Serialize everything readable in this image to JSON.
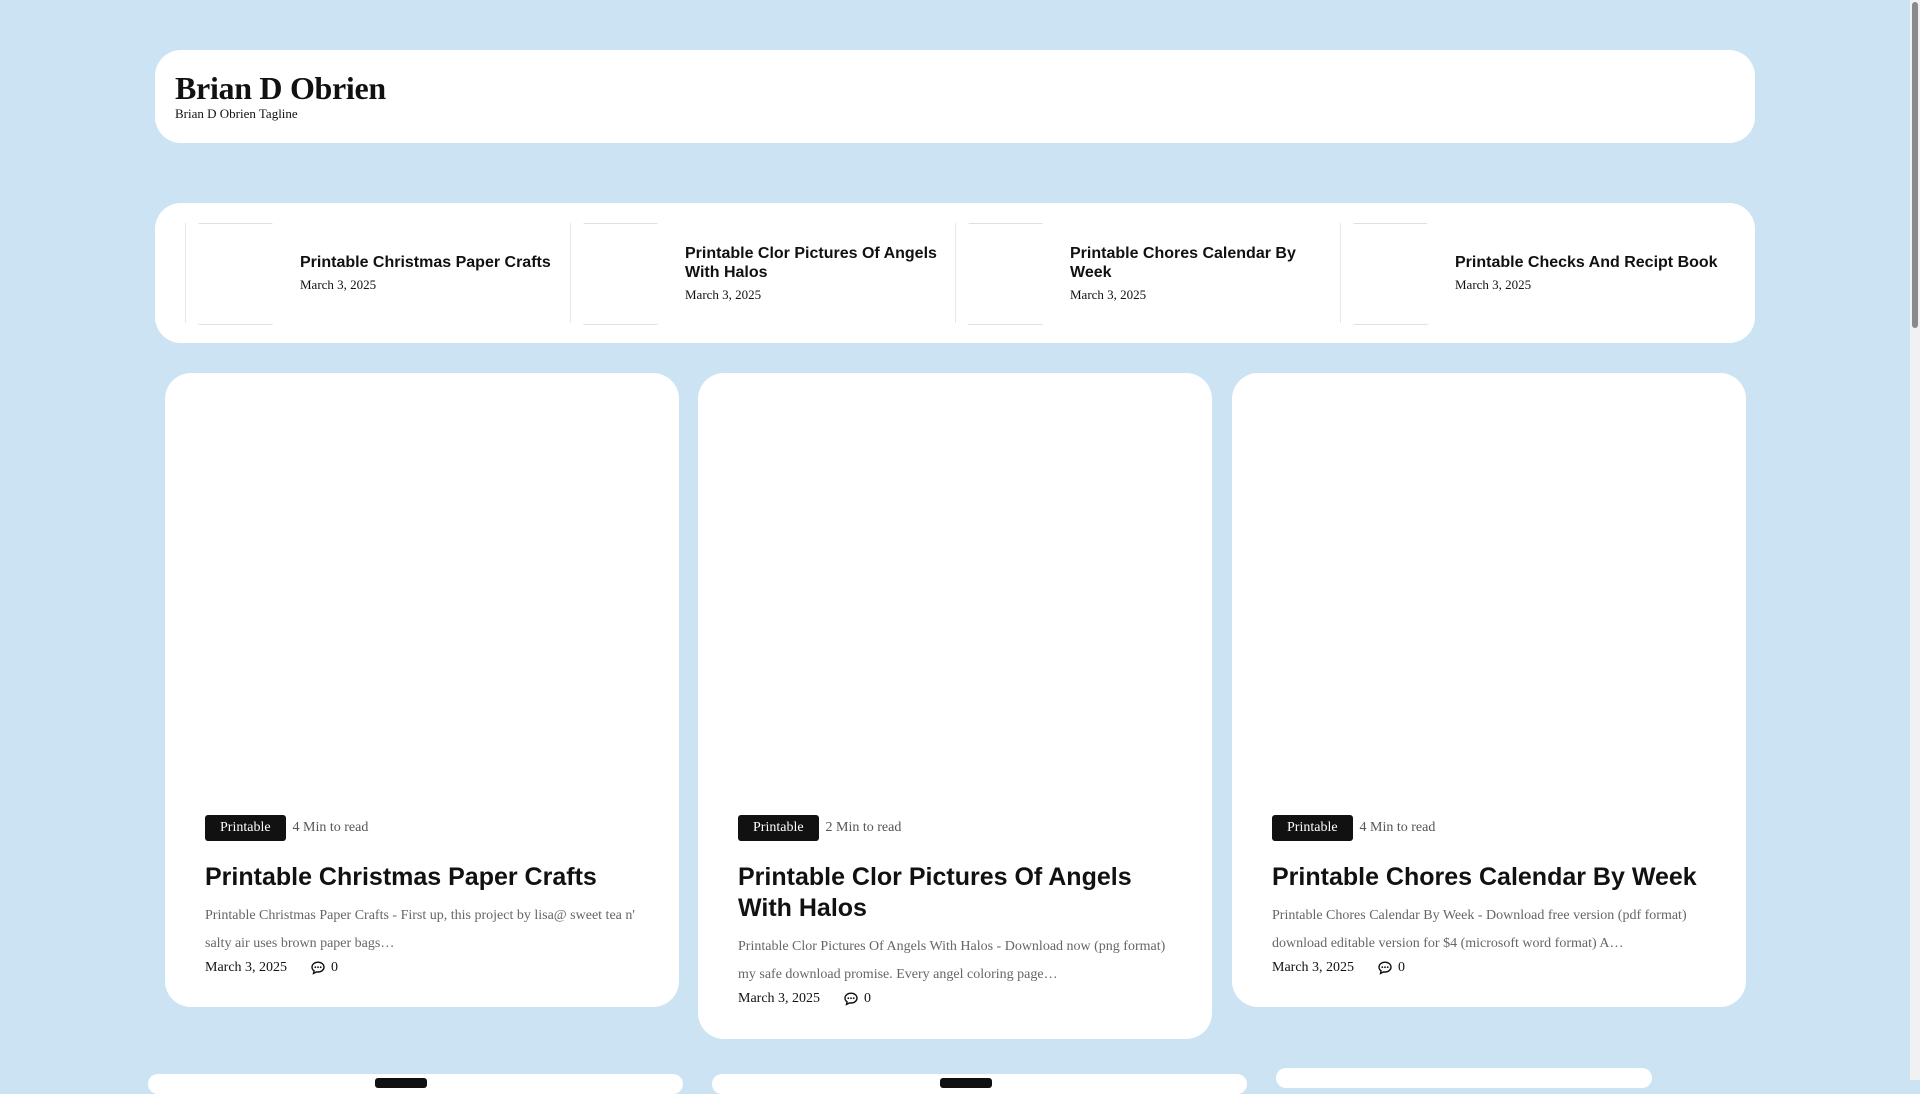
{
  "site": {
    "title": "Brian D Obrien",
    "tagline": "Brian D Obrien Tagline"
  },
  "recent_strip": [
    {
      "title": "Printable Christmas Paper Crafts",
      "date": "March 3, 2025"
    },
    {
      "title": "Printable Clor Pictures Of Angels With Halos",
      "date": "March 3, 2025"
    },
    {
      "title": "Printable Chores Calendar By Week",
      "date": "March 3, 2025"
    },
    {
      "title": "Printable Checks And Recipt Book",
      "date": "March 3, 2025"
    }
  ],
  "cards": [
    {
      "category": "Printable",
      "read_time": "4 Min to read",
      "title": "Printable Christmas Paper Crafts",
      "excerpt": "Printable Christmas Paper Crafts - First up, this project by lisa@ sweet tea n' salty air uses brown paper bags…",
      "date": "March 3, 2025",
      "comments": "0"
    },
    {
      "category": "Printable",
      "read_time": "2 Min to read",
      "title": "Printable Clor Pictures Of Angels With Halos",
      "excerpt": "Printable Clor Pictures Of Angels With Halos - Download now (png format) my safe download promise. Every angel coloring page…",
      "date": "March 3, 2025",
      "comments": "0"
    },
    {
      "category": "Printable",
      "read_time": "4 Min to read",
      "title": "Printable Chores Calendar By Week",
      "excerpt": "Printable Chores Calendar By Week - Download free version (pdf format) download editable version for $4 (microsoft word format) A…",
      "date": "March 3, 2025",
      "comments": "0"
    }
  ],
  "icons": {
    "comment": "comment-icon"
  },
  "colors": {
    "background": "#cce3f3",
    "card": "#ffffff",
    "badge": "#111111"
  }
}
